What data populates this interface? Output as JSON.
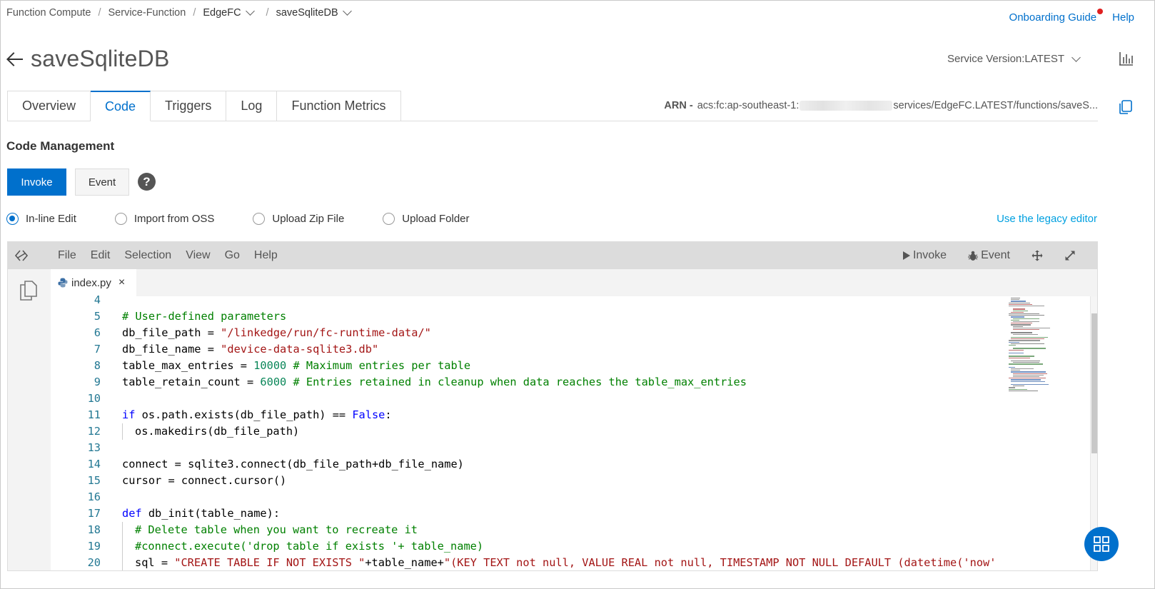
{
  "breadcrumb": {
    "items": [
      "Function Compute",
      "Service-Function",
      "EdgeFC",
      "saveSqliteDB"
    ],
    "separator": "/"
  },
  "top_links": {
    "onboarding": "Onboarding Guide",
    "help": "Help"
  },
  "page": {
    "title": "saveSqliteDB"
  },
  "service_version": "Service Version:LATEST",
  "tabs": [
    "Overview",
    "Code",
    "Triggers",
    "Log",
    "Function Metrics"
  ],
  "active_tab": "Code",
  "arn": {
    "label": "ARN -",
    "prefix": "acs:fc:ap-southeast-1:",
    "suffix": "services/EdgeFC.LATEST/functions/saveS..."
  },
  "section_title": "Code Management",
  "buttons": {
    "invoke": "Invoke",
    "event": "Event",
    "help": "?"
  },
  "radios": {
    "options": [
      "In-line Edit",
      "Import from OSS",
      "Upload Zip File",
      "Upload Folder"
    ],
    "selected": "In-line Edit"
  },
  "legacy_editor": "Use the legacy editor",
  "editor": {
    "menu": [
      "File",
      "Edit",
      "Selection",
      "View",
      "Go",
      "Help"
    ],
    "toolbar": {
      "invoke": "Invoke",
      "event": "Event"
    },
    "file_tab": {
      "name": "index.py",
      "close": "×"
    },
    "line_numbers": [
      "4",
      "5",
      "6",
      "7",
      "8",
      "9",
      "10",
      "11",
      "12",
      "13",
      "14",
      "15",
      "16",
      "17",
      "18",
      "19",
      "20"
    ],
    "code": {
      "l5": "# User-defined parameters",
      "l6a": "db_file_path = ",
      "l6b": "\"/linkedge/run/fc-runtime-data/\"",
      "l7a": "db_file_name = ",
      "l7b": "\"device-data-sqlite3.db\"",
      "l8a": "table_max_entries = ",
      "l8b": "10000",
      "l8c": " # Maximum entries per table",
      "l9a": "table_retain_count = ",
      "l9b": "6000",
      "l9c": " # Entries retained in cleanup when data reaches the table_max_entries",
      "l11a": "if",
      "l11b": " os.path.exists(db_file_path) == ",
      "l11c": "False",
      "l11d": ":",
      "l12": "os.makedirs(db_file_path)",
      "l14": "connect = sqlite3.connect(db_file_path+db_file_name)",
      "l15": "cursor = connect.cursor()",
      "l17a": "def",
      "l17b": " db_init(table_name):",
      "l18": "# Delete table when you want to recreate it",
      "l19": "#connect.execute('drop table if exists '+ table_name)",
      "l20a": "sql = ",
      "l20b": "\"CREATE TABLE IF NOT EXISTS \"",
      "l20c": "+table_name+",
      "l20d": "\"(KEY TEXT not null, VALUE REAL not null, TIMESTAMP NOT NULL DEFAULT (datetime('now'"
    }
  },
  "colors": {
    "primary": "#0070cc",
    "legacy_link": "#00a0e0",
    "comment": "#008000",
    "string": "#a31515",
    "number": "#098658",
    "keyword": "#0000ff",
    "line_number": "#237893",
    "notification_dot": "#e02020"
  }
}
